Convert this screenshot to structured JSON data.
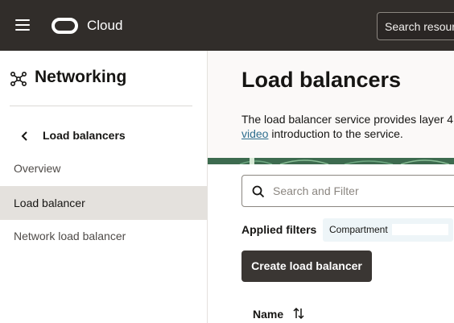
{
  "topbar": {
    "brand": "Cloud",
    "search_placeholder": "Search resources"
  },
  "sidebar": {
    "title": "Networking",
    "subtitle": "Load balancers",
    "items": [
      {
        "label": "Overview",
        "active": false
      },
      {
        "label": "Load balancer",
        "active": true
      },
      {
        "label": "Network load balancer",
        "active": false
      }
    ]
  },
  "main": {
    "title": "Load balancers",
    "description_line1": "The load balancer service provides layer 4",
    "description_link": "video",
    "description_line2_rest": " introduction to the service.",
    "filter_placeholder": "Search and Filter",
    "applied_filters_label": "Applied filters",
    "filter_chip": "Compartment",
    "create_button": "Create load balancer",
    "table": {
      "columns": [
        "Name"
      ]
    }
  },
  "colors": {
    "header_bg": "#312d2a",
    "active_item_bg": "#e4e1dd",
    "primary_button": "#3a3633",
    "link": "#2e6e8e"
  },
  "icons": [
    "menu-icon",
    "oracle-logo",
    "networking-icon",
    "chevron-left-icon",
    "search-icon",
    "sort-icon"
  ]
}
